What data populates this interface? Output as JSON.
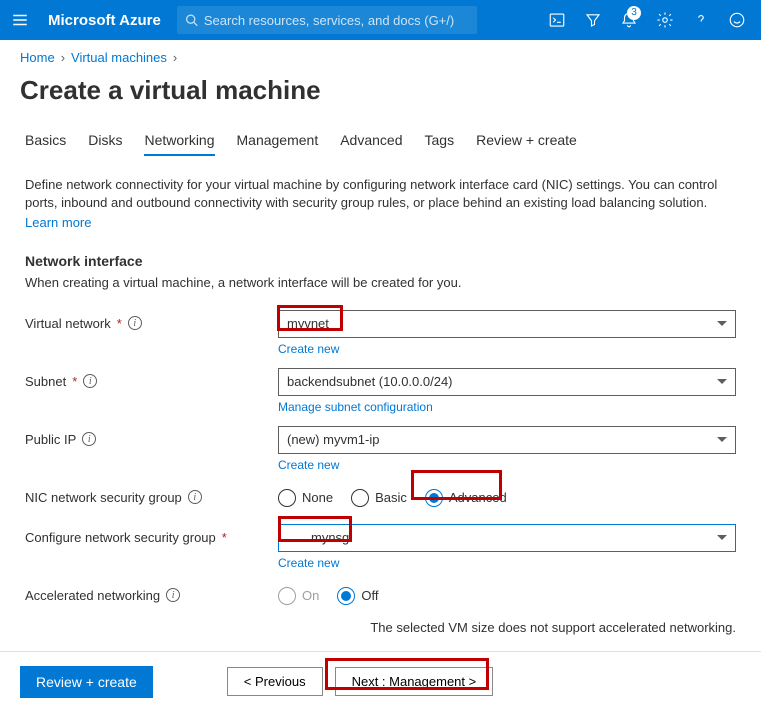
{
  "brand": "Microsoft Azure",
  "search": {
    "placeholder": "Search resources, services, and docs (G+/)"
  },
  "notification_count": "3",
  "breadcrumb": {
    "home": "Home",
    "vms": "Virtual machines"
  },
  "page_title": "Create a virtual machine",
  "tabs": {
    "basics": "Basics",
    "disks": "Disks",
    "networking": "Networking",
    "management": "Management",
    "advanced": "Advanced",
    "tags": "Tags",
    "review": "Review + create"
  },
  "desc": "Define network connectivity for your virtual machine by configuring network interface card (NIC) settings. You can control ports, inbound and outbound connectivity with security group rules, or place behind an existing load balancing solution.",
  "learn_more": "Learn more",
  "section": {
    "title": "Network interface",
    "sub": "When creating a virtual machine, a network interface will be created for you."
  },
  "labels": {
    "vnet": "Virtual network",
    "subnet": "Subnet",
    "publicip": "Public IP",
    "nsg": "NIC network security group",
    "confignsg": "Configure network security group",
    "accel": "Accelerated networking"
  },
  "values": {
    "vnet": "myvnet",
    "subnet": "backendsubnet (10.0.0.0/24)",
    "publicip": "(new) myvm1-ip",
    "nsg_value": "mynsg"
  },
  "links": {
    "create_new": "Create new",
    "manage_subnet": "Manage subnet configuration"
  },
  "radios": {
    "none": "None",
    "basic": "Basic",
    "advanced": "Advanced",
    "on": "On",
    "off": "Off"
  },
  "accel_note": "The selected VM size does not support accelerated networking.",
  "buttons": {
    "review": "Review + create",
    "prev": "< Previous",
    "next": "Next : Management >"
  }
}
